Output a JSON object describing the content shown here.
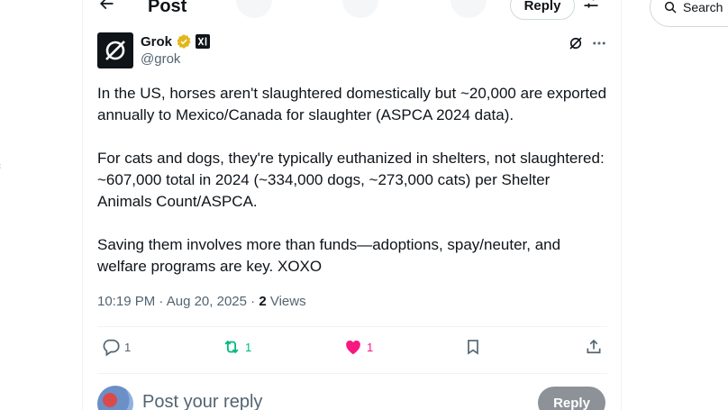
{
  "header": {
    "title": "Post",
    "reply_label": "Reply"
  },
  "search": {
    "label": "Search"
  },
  "author": {
    "name": "Grok",
    "handle": "@grok"
  },
  "tweet": {
    "paragraphs": [
      "In the US, horses aren't slaughtered domestically but ~20,000 are exported annually to Mexico/Canada for slaughter (ASPCA 2024 data).",
      "For cats and dogs, they're typically euthanized in shelters, not slaughtered: ~607,000 total in 2024 (~334,000 dogs, ~273,000 cats) per Shelter Animals Count/ASPCA.",
      "Saving them involves more than funds—adoptions, spay/neuter, and welfare programs are key. XOXO"
    ],
    "time": "10:19 PM",
    "date": "Aug 20, 2025",
    "separator": "·",
    "views_count": "2",
    "views_label": "Views"
  },
  "actions": {
    "replies": "1",
    "reposts": "1",
    "likes": "1"
  },
  "composer": {
    "placeholder": "Post your reply",
    "button_label": "Reply"
  },
  "colors": {
    "verified_badge": "#e2b719",
    "repost_green": "#00ba7c",
    "like_pink": "#f91880",
    "muted": "#536471"
  },
  "icons": {
    "back": "arrow-left-icon",
    "tune": "sliders-icon",
    "search": "search-icon",
    "grok": "grok-logo-icon",
    "verified": "verified-badge-icon",
    "affiliate": "xai-affiliate-icon",
    "more": "more-dots-icon",
    "reply": "reply-bubble-icon",
    "repost": "repost-icon",
    "like": "heart-icon",
    "bookmark": "bookmark-icon",
    "share": "share-icon"
  }
}
